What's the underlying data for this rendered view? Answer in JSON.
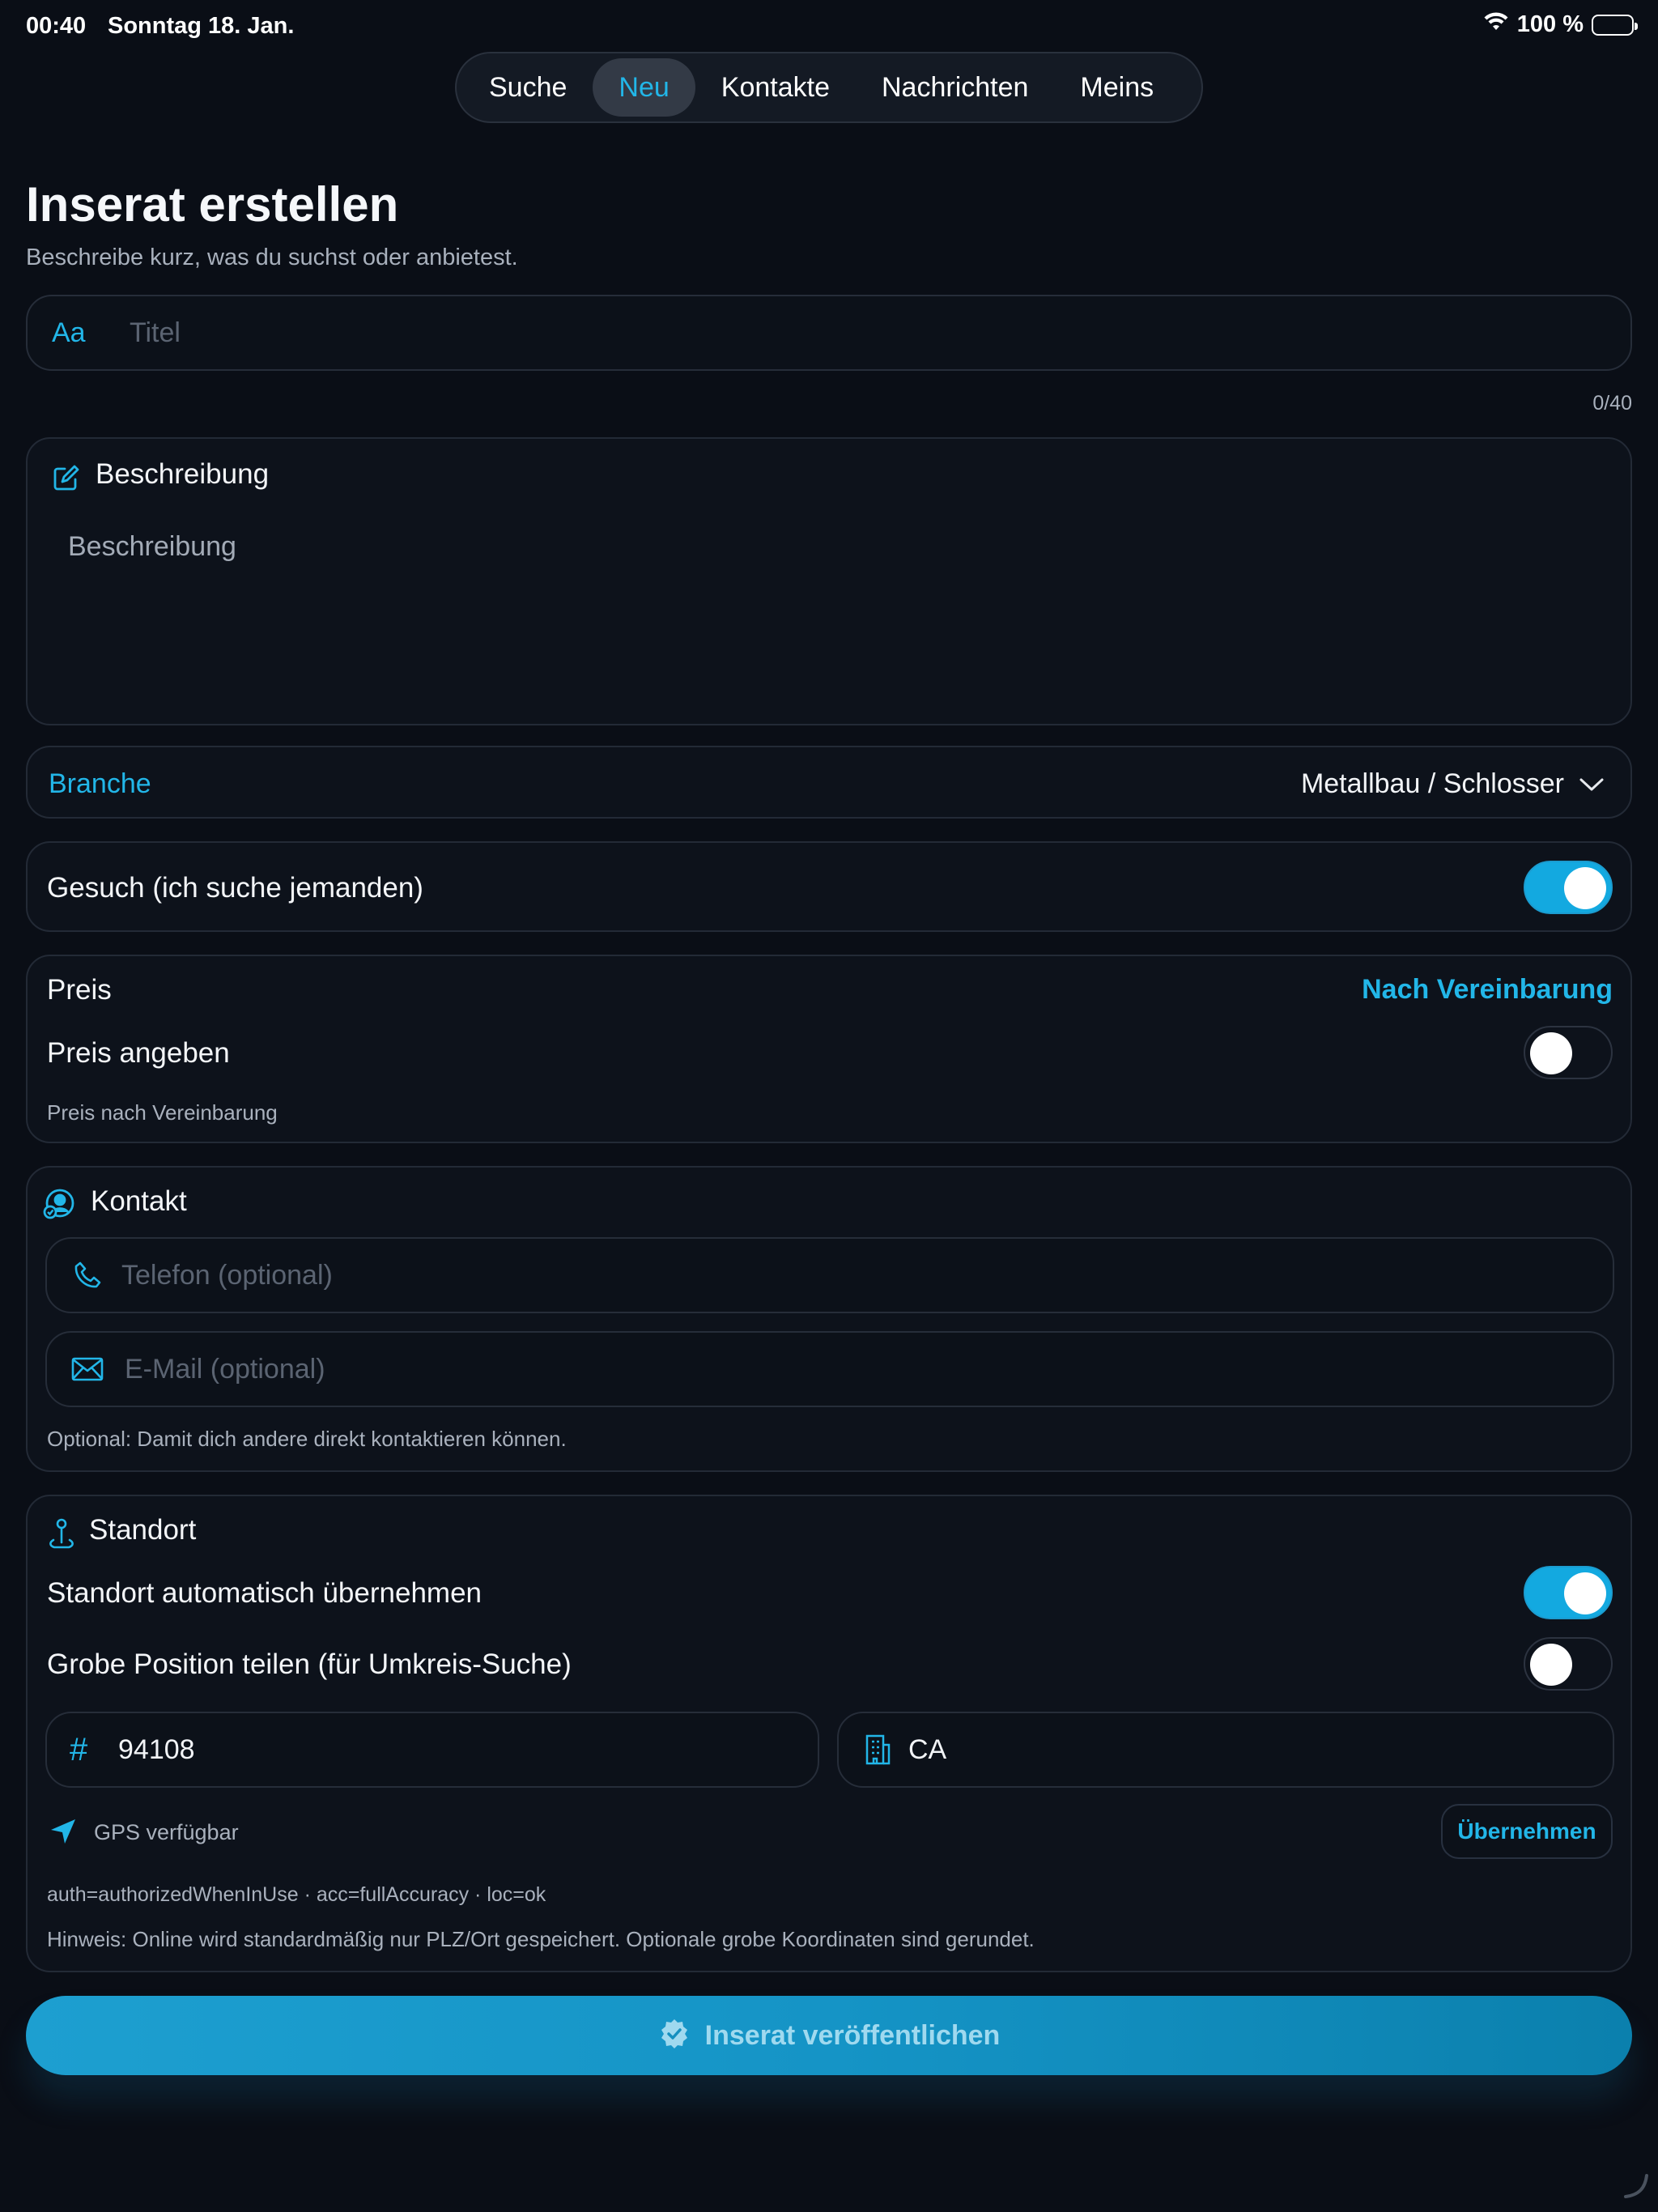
{
  "status_bar": {
    "time": "00:40",
    "date": "Sonntag 18. Jan.",
    "battery": "100 %"
  },
  "tabs": [
    {
      "label": "Suche",
      "active": false
    },
    {
      "label": "Neu",
      "active": true
    },
    {
      "label": "Kontakte",
      "active": false
    },
    {
      "label": "Nachrichten",
      "active": false
    },
    {
      "label": "Meins",
      "active": false
    }
  ],
  "page": {
    "title": "Inserat erstellen",
    "subtitle": "Beschreibe kurz, was du suchst oder anbietest."
  },
  "title_field": {
    "prefix": "Aa",
    "placeholder": "Titel",
    "counter": "0/40"
  },
  "description": {
    "header": "Beschreibung",
    "placeholder": "Beschreibung"
  },
  "branche": {
    "label": "Branche",
    "value": "Metallbau / Schlosser"
  },
  "gesuch": {
    "label": "Gesuch (ich suche jemanden)",
    "enabled": true
  },
  "price": {
    "label": "Preis",
    "value": "Nach Vereinbarung",
    "toggle_label": "Preis angeben",
    "enabled": false,
    "hint": "Preis nach Vereinbarung"
  },
  "contact": {
    "header": "Kontakt",
    "phone_placeholder": "Telefon (optional)",
    "email_placeholder": "E-Mail (optional)",
    "hint": "Optional: Damit dich andere direkt kontaktieren können."
  },
  "location": {
    "header": "Standort",
    "auto_label": "Standort automatisch übernehmen",
    "auto_enabled": true,
    "coarse_label": "Grobe Position teilen (für Umkreis-Suche)",
    "coarse_enabled": false,
    "zip": "94108",
    "city": "CA",
    "gps_status": "GPS verfügbar",
    "apply_button": "Übernehmen",
    "debug": "auth=authorizedWhenInUse · acc=fullAccuracy · loc=ok",
    "note": "Hinweis: Online wird standardmäßig nur PLZ/Ort gespeichert. Optionale grobe Koordinaten sind gerundet."
  },
  "publish_button": "Inserat veröffentlichen",
  "colors": {
    "accent": "#22b6e8",
    "background": "#0a0e16",
    "card": "#0d121b"
  }
}
